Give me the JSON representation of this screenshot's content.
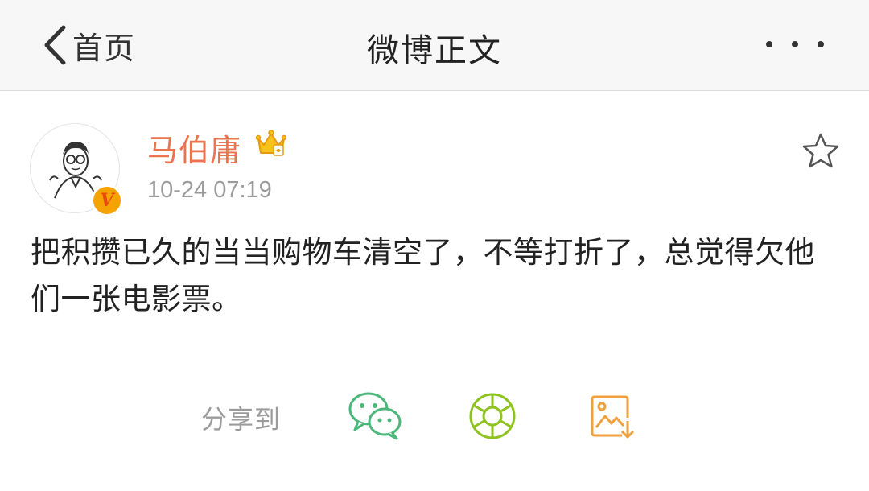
{
  "nav": {
    "back_label": "首页",
    "title": "微博正文"
  },
  "post": {
    "author": "马伯庸",
    "verified_badge": "V",
    "timestamp": "10-24 07:19",
    "text": "把积攒已久的当当购物车清空了，不等打折了，总觉得欠他们一张电影票。"
  },
  "share": {
    "label": "分享到",
    "targets": [
      "wechat-icon",
      "moments-icon",
      "save-image-icon"
    ]
  },
  "colors": {
    "author": "#eb7350",
    "wechat": "#4bb77a",
    "moments": "#8dc21f",
    "save_image": "#f0a03c"
  }
}
